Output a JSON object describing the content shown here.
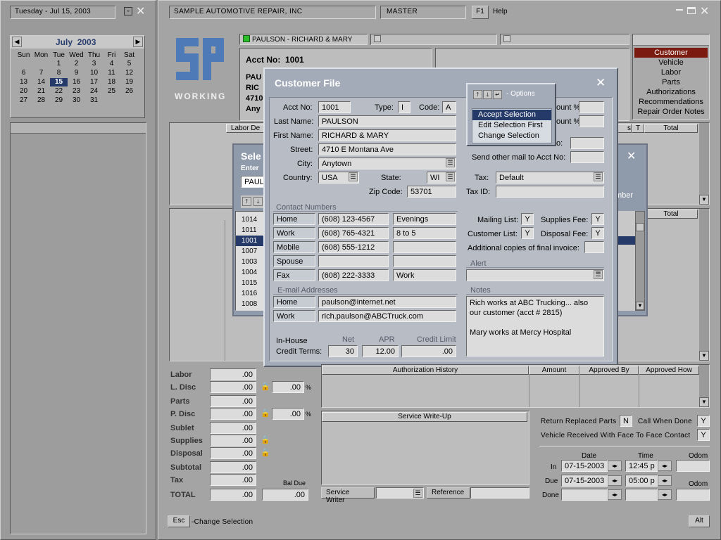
{
  "left": {
    "date_label": "Tuesday - Jul 15, 2003",
    "calendar": {
      "month": "July",
      "year": "2003",
      "weekdays": [
        "Sun",
        "Mon",
        "Tue",
        "Wed",
        "Thu",
        "Fri",
        "Sat"
      ],
      "weeks": [
        [
          "",
          "",
          "1",
          "2",
          "3",
          "4",
          "5"
        ],
        [
          "6",
          "7",
          "8",
          "9",
          "10",
          "11",
          "12"
        ],
        [
          "13",
          "14",
          "15",
          "16",
          "17",
          "18",
          "19"
        ],
        [
          "20",
          "21",
          "22",
          "23",
          "24",
          "25",
          "26"
        ],
        [
          "27",
          "28",
          "29",
          "30",
          "31",
          "",
          ""
        ]
      ],
      "selected": "15"
    }
  },
  "topbar": {
    "company": "SAMPLE AUTOMOTIVE REPAIR, INC",
    "mode": "MASTER",
    "f1": "F1",
    "help": "Help"
  },
  "logo": {
    "working": "WORKING"
  },
  "customer_tab": "PAULSON - RICHARD & MARY",
  "bg": {
    "acct_label": "Acct No:",
    "acct_value": "1001",
    "partial_lines": [
      "PAU",
      "RIC",
      "4710",
      "Any"
    ],
    "labor_col": "Labor",
    "de_col": "De",
    "total_col1": "Total",
    "total_col2": "Total",
    "t_col": "T",
    "s_col": "s",
    "mber": "mber"
  },
  "right_menu": {
    "items": [
      "Customer",
      "Vehicle",
      "Labor",
      "Parts",
      "Authorizations",
      "Recommendations",
      "Repair Order Notes"
    ],
    "selected": "Customer"
  },
  "select_dialog": {
    "title": "Sele",
    "enter": "Enter",
    "input": "PAUL",
    "list": [
      "1014",
      "1011",
      "1001",
      "1007",
      "1003",
      "1004",
      "1015",
      "1016",
      "1008"
    ],
    "selected": "1001"
  },
  "customer_file": {
    "title": "Customer File",
    "acct_label": "Acct No:",
    "acct": "1001",
    "type_label": "Type:",
    "type": "I",
    "code_label": "Code:",
    "code": "A",
    "last_label": "Last Name:",
    "last": "PAULSON",
    "first_label": "First Name:",
    "first": "RICHARD & MARY",
    "street_label": "Street:",
    "street": "4710 E Montana Ave",
    "city_label": "City:",
    "city": "Anytown",
    "country_label": "Country:",
    "country": "USA",
    "state_label": "State:",
    "state": "WI",
    "zip_label": "Zip Code:",
    "zip": "53701",
    "tax_label": "Tax:",
    "tax": "Default",
    "taxid_label": "Tax ID:",
    "taxid": "",
    "pct1_label": "ount %",
    "pct2_label": "ount %",
    "no_label": "o:",
    "mail_other_label": "Send other mail to Acct No:",
    "contact_header": "Contact Numbers",
    "contacts": [
      {
        "type": "Home",
        "number": "(608) 123-4567",
        "note": "Evenings"
      },
      {
        "type": "Work",
        "number": "(608) 765-4321",
        "note": "8 to 5"
      },
      {
        "type": "Mobile",
        "number": "(608) 555-1212",
        "note": ""
      },
      {
        "type": "Spouse",
        "number": "",
        "note": ""
      },
      {
        "type": "Fax",
        "number": "(608) 222-3333",
        "note": "Work"
      }
    ],
    "email_header": "E-mail Addresses",
    "emails": [
      {
        "type": "Home",
        "address": "paulson@internet.net"
      },
      {
        "type": "Work",
        "address": "rich.paulson@ABCTruck.com"
      }
    ],
    "mailing_list_label": "Mailing List:",
    "mailing_list": "Y",
    "supplies_fee_label": "Supplies Fee:",
    "supplies_fee": "Y",
    "customer_list_label": "Customer List:",
    "customer_list": "Y",
    "disposal_fee_label": "Disposal Fee:",
    "disposal_fee": "Y",
    "copies_label": "Additional copies of final invoice:",
    "copies": "",
    "alert_label": "Alert",
    "alert": "",
    "notes_label": "Notes",
    "notes_lines": [
      "Rich works at ABC Trucking...  also",
      "our customer (acct # 2815)",
      "",
      "Mary works at Mercy Hospital"
    ],
    "inhouse_label": "In-House",
    "credit_terms_label": "Credit Terms:",
    "net_label": "Net",
    "net": "30",
    "apr_label": "APR",
    "apr": "12.00",
    "limit_label": "Credit Limit",
    "limit": ".00"
  },
  "options_popup": {
    "title": "- Options",
    "items": [
      "Accept Selection",
      "Edit Selection First",
      "Change Selection"
    ],
    "selected": "Accept Selection"
  },
  "totals": {
    "rows": [
      {
        "label": "Labor",
        "value": ".00"
      },
      {
        "label": "L. Disc",
        "value": ".00"
      },
      {
        "label": "Parts",
        "value": ".00"
      },
      {
        "label": "P. Disc",
        "value": ".00"
      },
      {
        "label": "Sublet",
        "value": ".00"
      },
      {
        "label": "Supplies",
        "value": ".00"
      },
      {
        "label": "Disposal",
        "value": ".00"
      },
      {
        "label": "Subtotal",
        "value": ".00"
      },
      {
        "label": "Tax",
        "value": ".00"
      }
    ],
    "ldisc_pct": ".00",
    "pdisc_pct": ".00",
    "pct_sign": "%",
    "total_label": "TOTAL",
    "total": ".00",
    "bal_due_label": "Bal Due",
    "bal_due": ".00"
  },
  "auth": {
    "col_history": "Authorization  History",
    "col_amount": "Amount",
    "col_by": "Approved By",
    "col_how": "Approved How"
  },
  "writeup": {
    "title": "Service  Write-Up",
    "writer_label": "Service Writer",
    "reference_label": "Reference"
  },
  "flags": {
    "return_parts_label": "Return Replaced Parts",
    "return_parts": "N",
    "call_done_label": "Call When Done",
    "call_done": "Y",
    "face_label": "Vehicle Received With Face To Face Contact",
    "face": "Y"
  },
  "dates": {
    "date_col": "Date",
    "time_col": "Time",
    "odom_col": "Odom",
    "odom_col2": "Odom",
    "in_label": "In",
    "in_date": "07-15-2003",
    "in_time": "12:45 p",
    "due_label": "Due",
    "due_date": "07-15-2003",
    "due_time": "05:00 p",
    "done_label": "Done",
    "done_date": "",
    "done_time": ""
  },
  "bottom": {
    "esc": "Esc",
    "esc_text": "-Change Selection",
    "alt": "Alt"
  }
}
